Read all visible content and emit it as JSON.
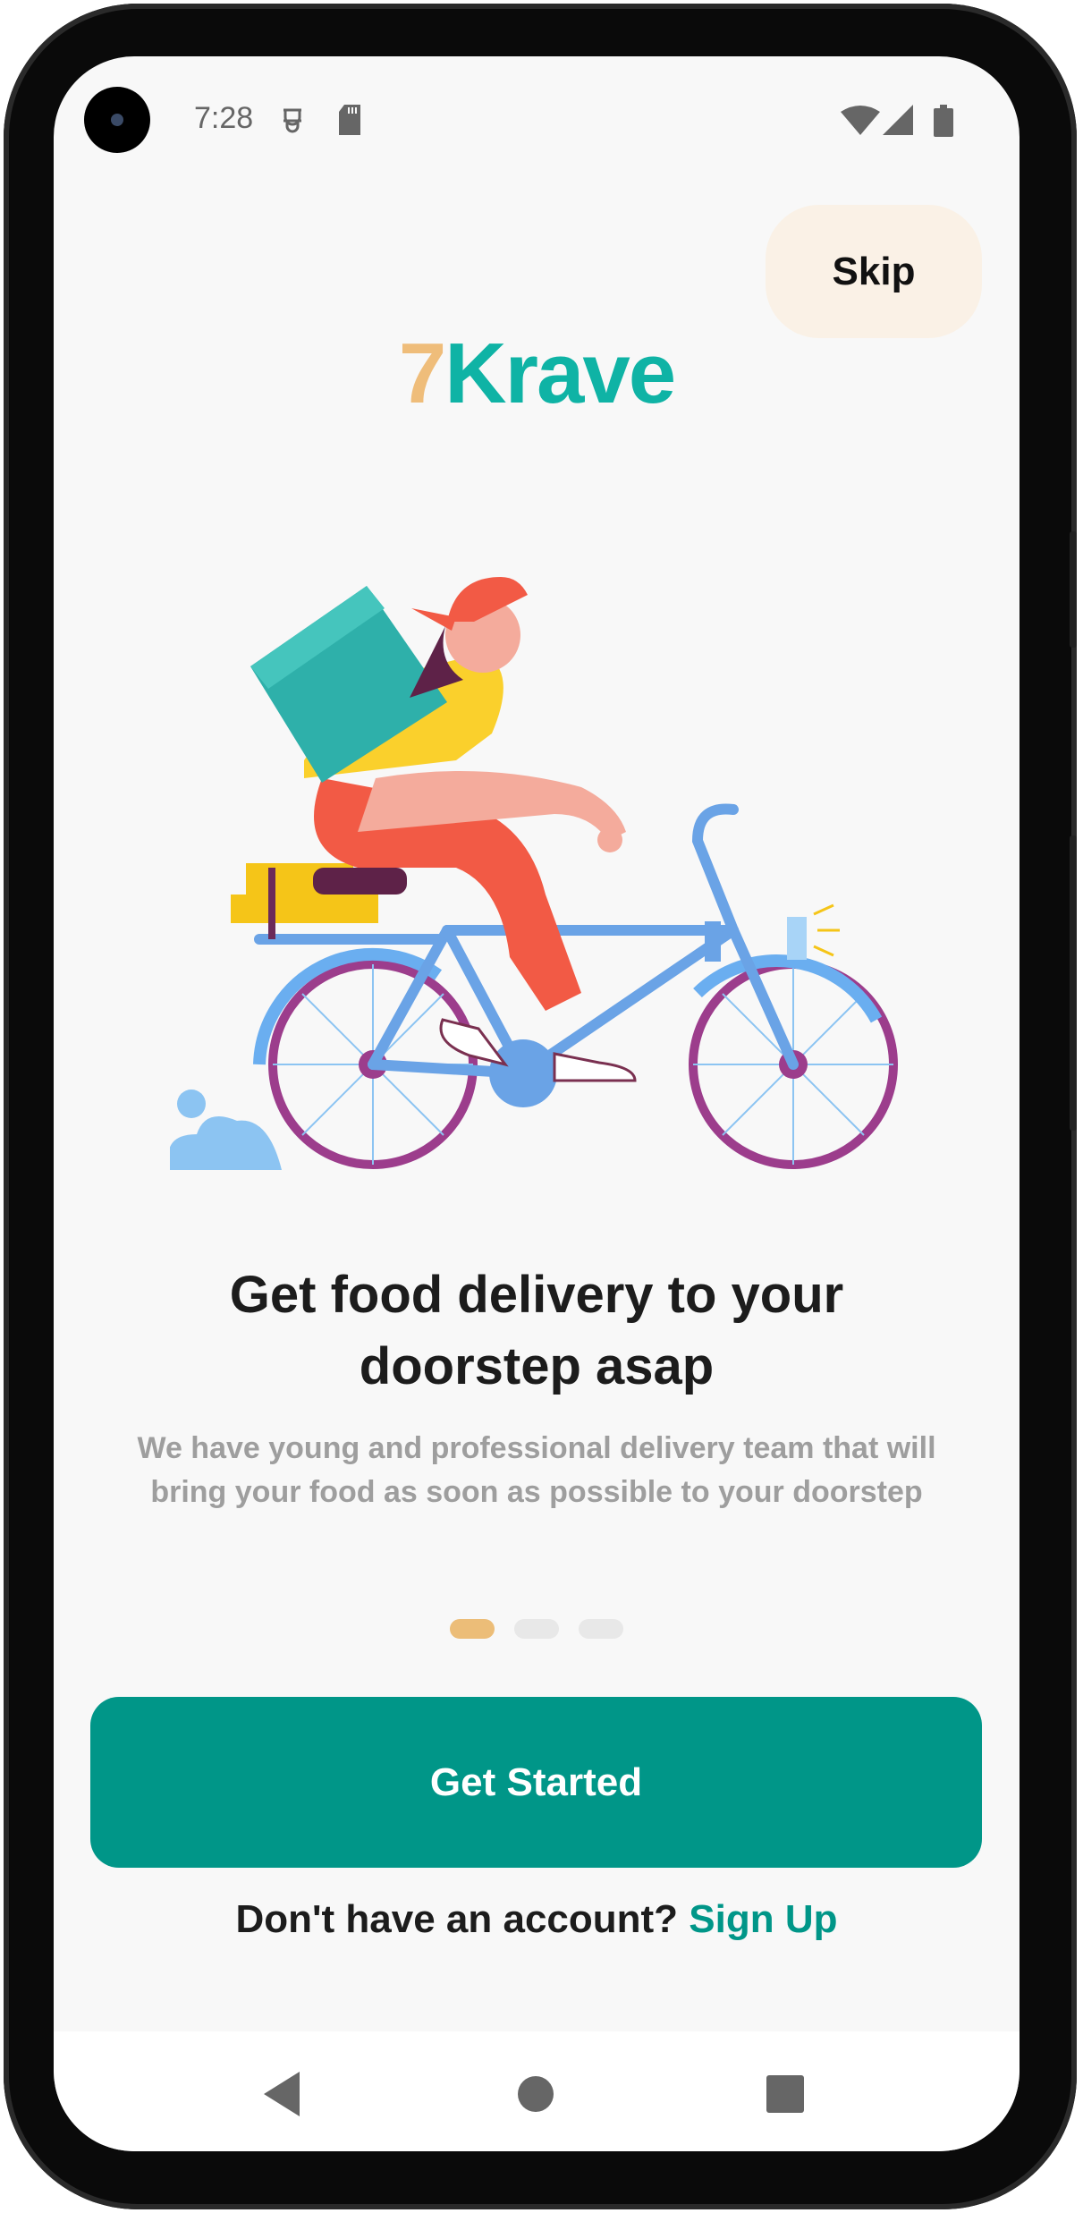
{
  "status_bar": {
    "time": "7:28",
    "icons": [
      "android-debug-icon",
      "sd-card-icon",
      "wifi-icon",
      "signal-icon",
      "battery-icon"
    ]
  },
  "header": {
    "skip_label": "Skip",
    "logo_seven": "7",
    "logo_name": "Krave"
  },
  "onboarding": {
    "title_line1": "Get food delivery to your",
    "title_line2": "doorstep asap",
    "subtitle": "We have young and professional delivery team that will bring your food as soon as possible to your doorstep",
    "page_count": 3,
    "current_page": 1
  },
  "actions": {
    "get_started_label": "Get Started",
    "account_prompt": "Don't have an account?",
    "signup_label": "Sign Up"
  },
  "colors": {
    "primary": "#009688",
    "logo_teal": "#0fb3a5",
    "logo_orange": "#efbd7a",
    "skip_bg": "#faf1e6",
    "dot_active": "#ecbd78"
  },
  "nav_bar": {
    "icons": [
      "back-icon",
      "home-icon",
      "recents-icon"
    ]
  }
}
